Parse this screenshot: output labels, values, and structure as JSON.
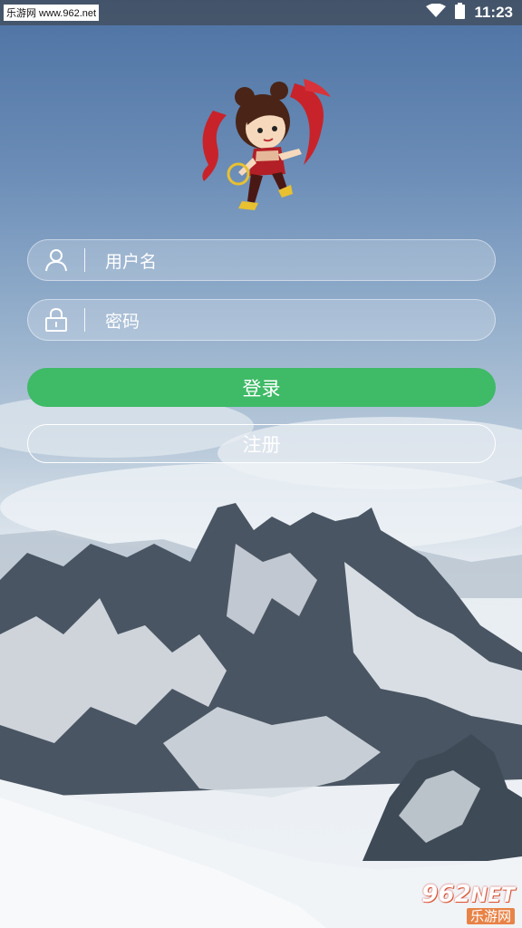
{
  "status_bar": {
    "watermark": "乐游网 www.962.net",
    "time": "11:23"
  },
  "login_form": {
    "username_placeholder": "用户名",
    "password_placeholder": "密码",
    "login_label": "登录",
    "register_label": "注册"
  },
  "watermark_bottom": {
    "logo_number": "962",
    "logo_suffix": "NET",
    "logo_sub": "乐游网"
  },
  "colors": {
    "login_button": "#3fba67",
    "field_border": "#ffffff"
  },
  "icons": {
    "username": "user-icon",
    "password": "lock-icon",
    "wifi": "wifi-icon",
    "battery": "battery-icon"
  }
}
